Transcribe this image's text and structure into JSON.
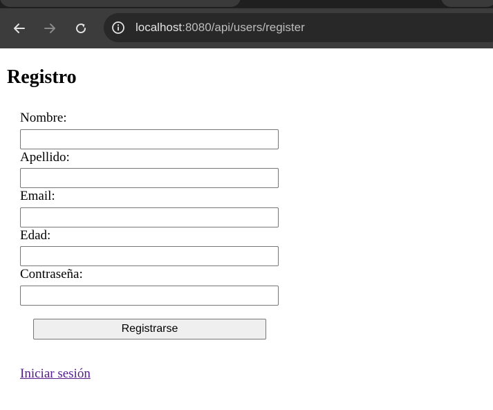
{
  "browser": {
    "url_host": "localhost",
    "url_path": ":8080/api/users/register"
  },
  "page": {
    "title": "Registro",
    "form": {
      "fields": [
        {
          "label": "Nombre:",
          "value": ""
        },
        {
          "label": "Apellido:",
          "value": ""
        },
        {
          "label": "Email:",
          "value": ""
        },
        {
          "label": "Edad:",
          "value": ""
        },
        {
          "label": "Contraseña:",
          "value": ""
        }
      ],
      "submit_label": "Registrarse"
    },
    "login_link": "Iniciar sesión"
  }
}
